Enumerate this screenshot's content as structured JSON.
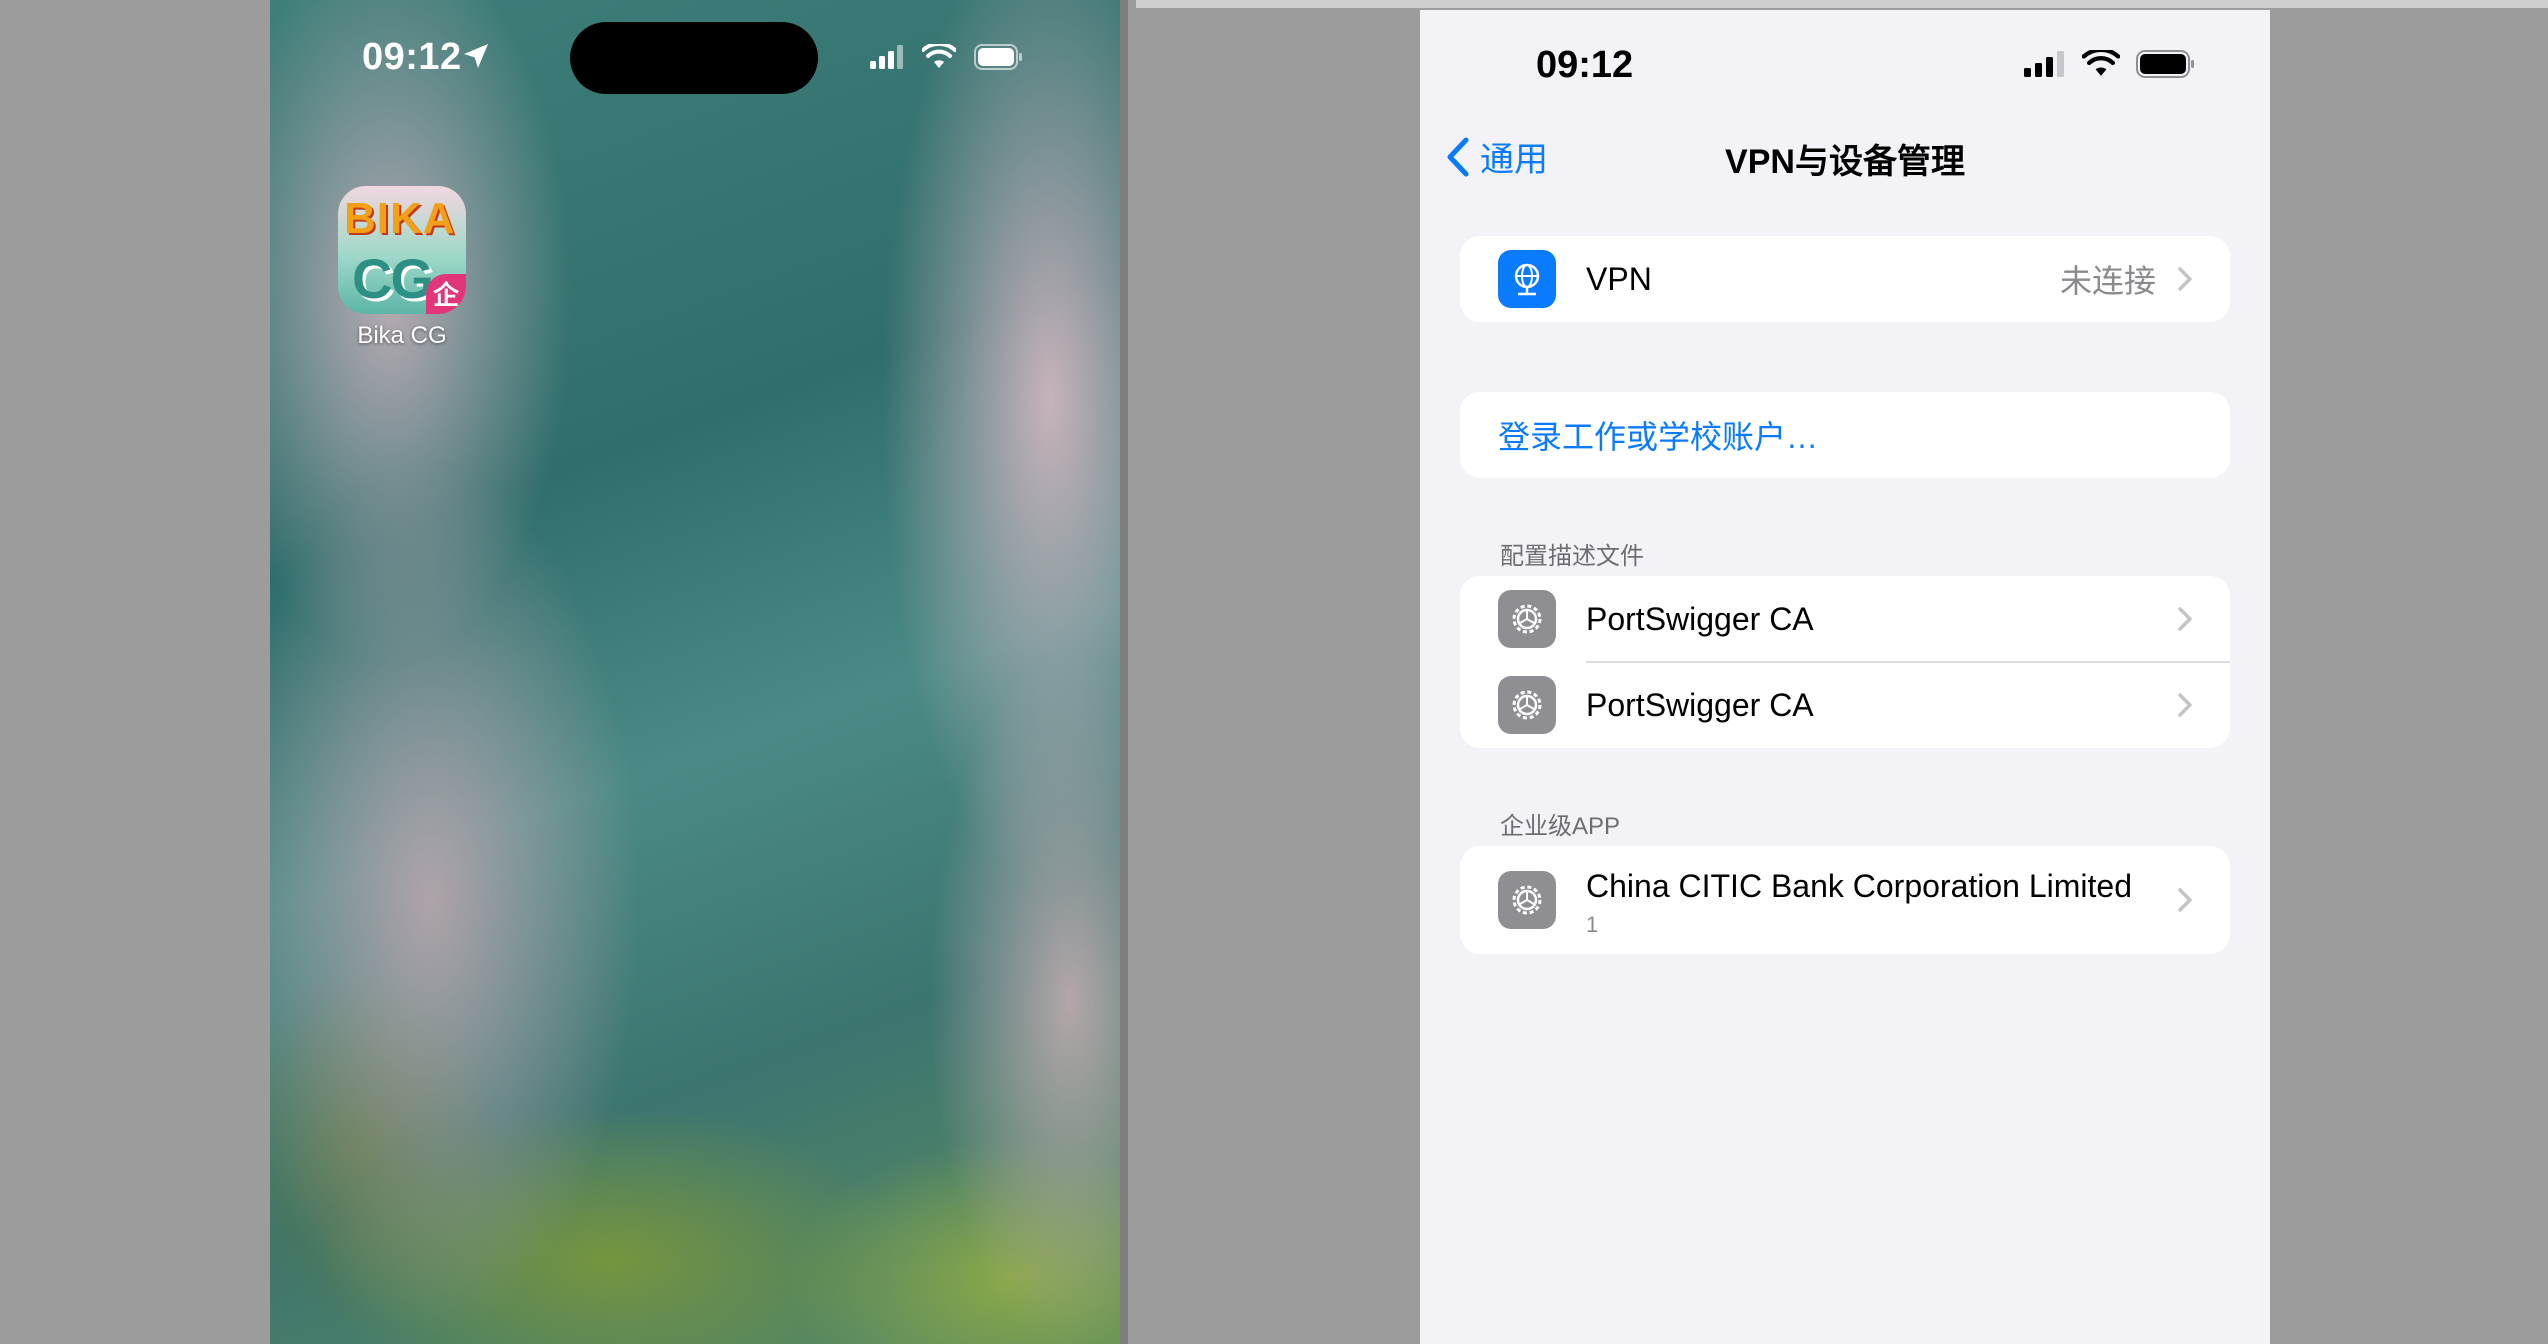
{
  "left_phone": {
    "status_bar": {
      "time": "09:12"
    },
    "app": {
      "name": "Bika CG",
      "icon_text_top": "BIKA",
      "icon_text_bottom": "CG",
      "icon_badge": "企"
    }
  },
  "right_phone": {
    "status_bar": {
      "time": "09:12"
    },
    "nav": {
      "back_label": "通用",
      "title": "VPN与设备管理"
    },
    "vpn": {
      "label": "VPN",
      "status": "未连接",
      "icon": "vpn-globe-icon"
    },
    "signin": {
      "label": "登录工作或学校账户…"
    },
    "profiles": {
      "header": "配置描述文件",
      "items": [
        {
          "label": "PortSwigger CA",
          "icon": "gear-icon"
        },
        {
          "label": "PortSwigger CA",
          "icon": "gear-icon"
        }
      ]
    },
    "enterprise": {
      "header": "企业级APP",
      "items": [
        {
          "label": "China CITIC Bank Corporation Limited",
          "sub": "1",
          "icon": "gear-icon"
        }
      ]
    }
  },
  "colors": {
    "accent": "#0a7aff",
    "vpn_icon_bg": "#0a7aff",
    "gear_icon_bg": "#8e8e93",
    "background": "#f2f2f7"
  }
}
